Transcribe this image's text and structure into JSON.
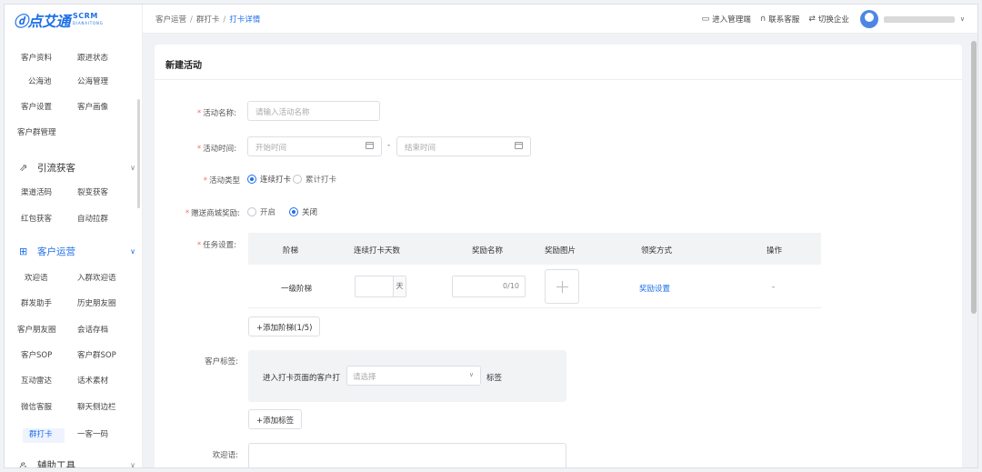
{
  "brand": {
    "logo_text": "点艾通",
    "logo_prefix": "ⓓ",
    "sub1": "SCRM",
    "sub2": "DIANAITONG"
  },
  "sidebar": {
    "rows": [
      [
        "客户资料",
        "跟进状态"
      ],
      [
        "公海池",
        "公海管理"
      ],
      [
        "客户设置",
        "客户画像"
      ],
      [
        "客户群管理",
        ""
      ]
    ],
    "groups": [
      {
        "label": "引流获客",
        "icon": "drainage-icon"
      },
      {
        "label": "客户运营",
        "icon": "grid-icon"
      },
      {
        "label": "辅助工具",
        "icon": "tools-icon"
      }
    ],
    "rows_lead": [
      [
        "渠道活码",
        "裂变获客"
      ],
      [
        "红包获客",
        "自动拉群"
      ]
    ],
    "rows_ops": [
      [
        "欢迎语",
        "入群欢迎语"
      ],
      [
        "群发助手",
        "历史朋友圈"
      ],
      [
        "客户朋友圈",
        "会话存档"
      ],
      [
        "客户SOP",
        "客户群SOP"
      ],
      [
        "互动雷达",
        "话术素材"
      ],
      [
        "微信客服",
        "聊天侧边栏"
      ],
      [
        "群打卡",
        "一客一码"
      ]
    ]
  },
  "topbar": {
    "breadcrumb": [
      "客户运营",
      "群打卡",
      "打卡详情"
    ],
    "actions": [
      {
        "label": "进入管理端",
        "icon": "monitor-icon"
      },
      {
        "label": "联系客服",
        "icon": "headset-icon"
      },
      {
        "label": "切换企业",
        "icon": "switch-icon"
      }
    ]
  },
  "form": {
    "title": "新建活动",
    "name_label": "活动名称:",
    "name_placeholder": "请输入活动名称",
    "time_label": "活动时间:",
    "start_placeholder": "开始时间",
    "end_placeholder": "结束时间",
    "range_sep": "-",
    "type_label": "活动类型",
    "type_options": [
      "连续打卡",
      "累计打卡"
    ],
    "reward_label": "赠送商城奖励:",
    "reward_options": [
      "开启",
      "关闭"
    ],
    "task_label": "任务设置:",
    "table_headers": [
      "阶梯",
      "连续打卡天数",
      "奖励名称",
      "奖励图片",
      "领奖方式",
      "操作"
    ],
    "row": {
      "tier": "一级阶梯",
      "days_unit": "天",
      "name_count": "0/10",
      "claim": "奖励设置",
      "op": "-"
    },
    "add_tier": "+添加阶梯(1/5)",
    "tag_label": "客户标签:",
    "tag_text": "进入打卡页面的客户打",
    "tag_select_placeholder": "请选择",
    "tag_suffix": "标签",
    "add_tag": "+添加标签",
    "welcome_label": "欢迎语:"
  }
}
